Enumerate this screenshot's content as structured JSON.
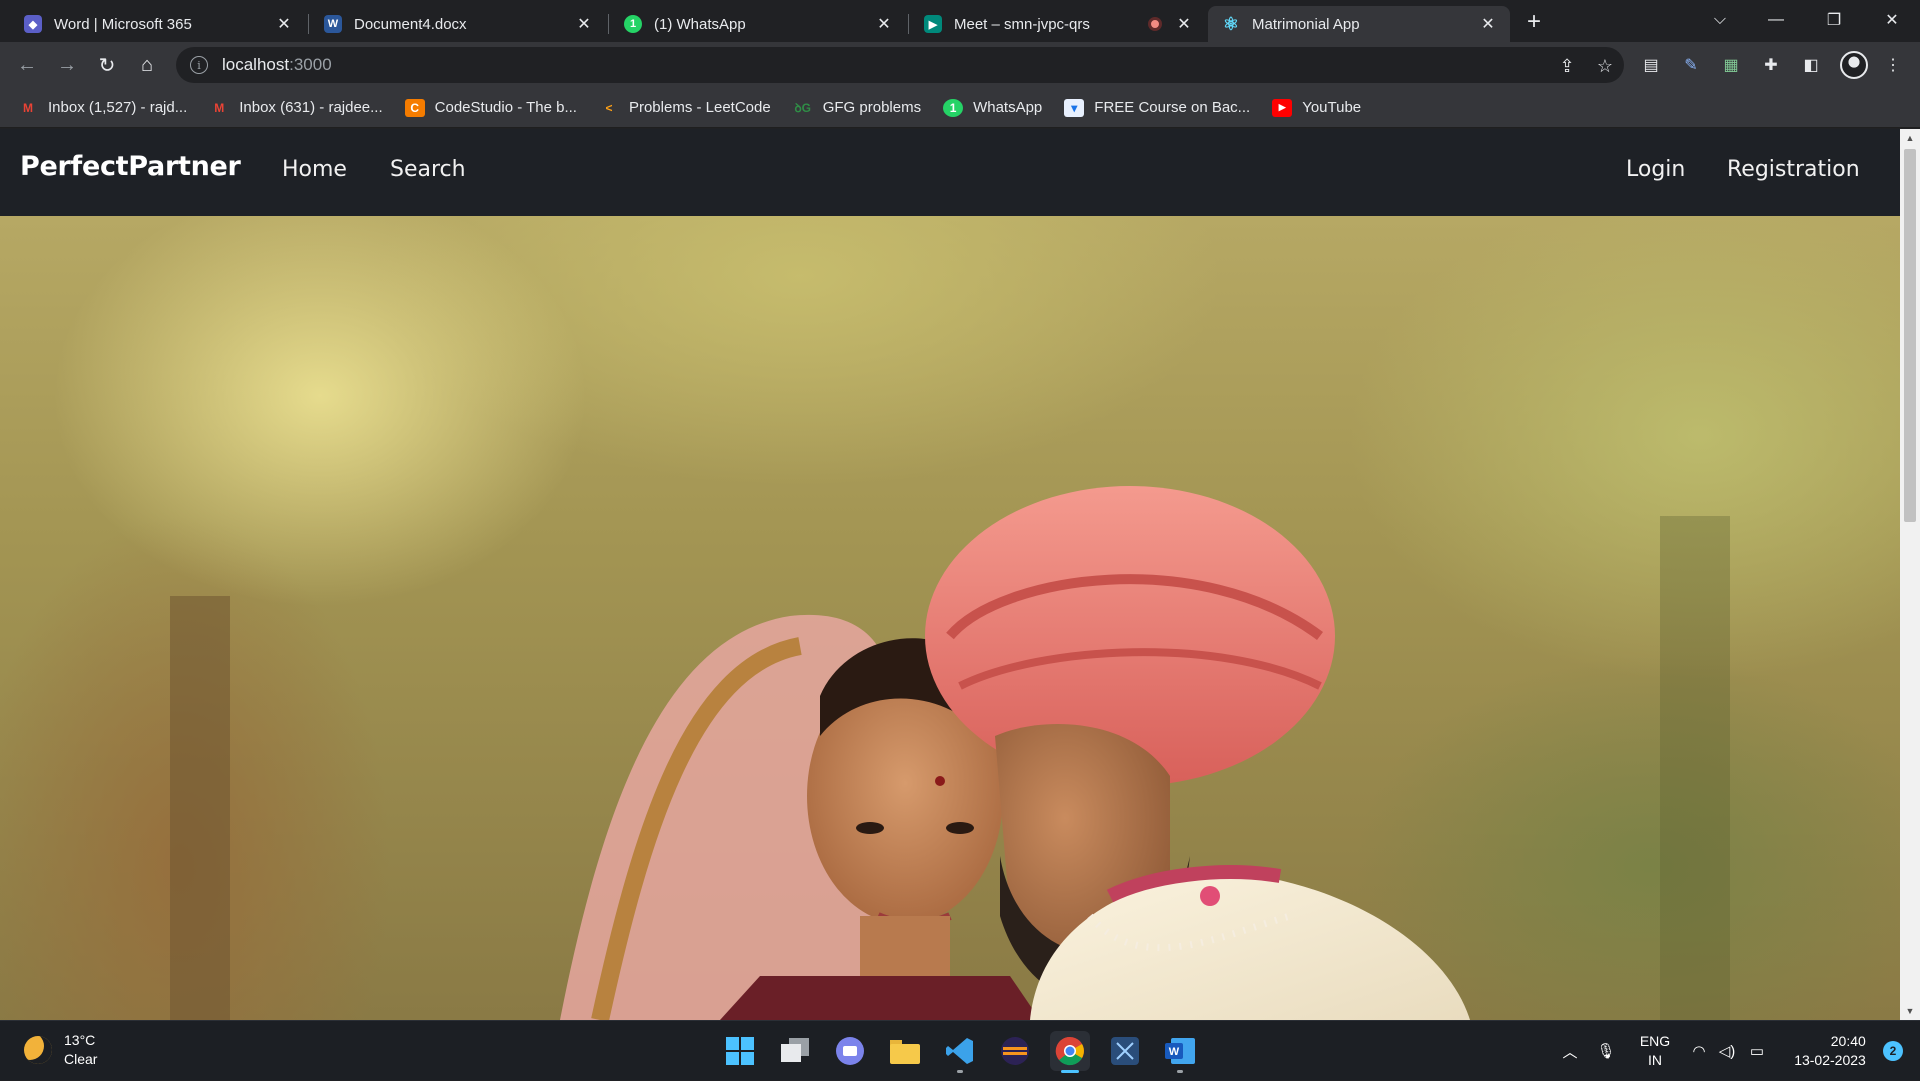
{
  "browser": {
    "tabs": [
      {
        "title": "Word | Microsoft 365",
        "favicon": "microsoft-365-icon",
        "color": "#6264a7"
      },
      {
        "title": "Document4.docx",
        "favicon": "word-icon",
        "color": "#2b579a"
      },
      {
        "title": "(1) WhatsApp",
        "favicon": "whatsapp-icon",
        "color": "#25d366"
      },
      {
        "title": "Meet – smn-jvpc-qrs",
        "favicon": "google-meet-icon",
        "color": "#00897b"
      },
      {
        "title": "Matrimonial App",
        "favicon": "react-icon",
        "color": "#61dafb"
      }
    ],
    "active_tab_index": 4,
    "url_host": "localhost",
    "url_port": ":3000",
    "bookmarks": [
      {
        "label": "Inbox (1,527) - rajd...",
        "icon": "gmail-icon"
      },
      {
        "label": "Inbox (631) - rajdee...",
        "icon": "gmail-icon"
      },
      {
        "label": "CodeStudio - The b...",
        "icon": "codestudio-icon"
      },
      {
        "label": "Problems - LeetCode",
        "icon": "leetcode-icon"
      },
      {
        "label": "GFG problems",
        "icon": "gfg-icon"
      },
      {
        "label": "WhatsApp",
        "icon": "whatsapp-icon"
      },
      {
        "label": "FREE Course on Bac...",
        "icon": "course-icon"
      },
      {
        "label": "YouTube",
        "icon": "youtube-icon"
      }
    ]
  },
  "site": {
    "brand": "PerfectPartner",
    "nav_left": [
      "Home",
      "Search"
    ],
    "nav_right": [
      "Login",
      "Registration"
    ],
    "hero_image": "wedding-couple-photo"
  },
  "taskbar": {
    "weather_temp": "13°C",
    "weather_desc": "Clear",
    "lang_line1": "ENG",
    "lang_line2": "IN",
    "time": "20:40",
    "date": "13-02-2023",
    "notification_count": "2"
  }
}
